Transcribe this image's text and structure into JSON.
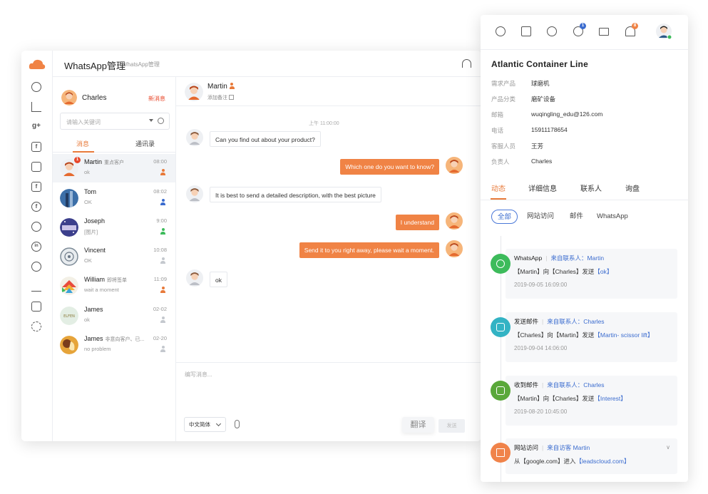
{
  "colors": {
    "accent": "#e87a3a",
    "orange_bubble": "#f08345",
    "link": "#3b6ccf",
    "whatsapp": "#3dbb5b",
    "email_out": "#33b3c4",
    "email_in": "#5aa83a",
    "visit": "#f0834a"
  },
  "main": {
    "title": "WhatsApp管理",
    "subtitle": "WhatsApp管理",
    "headset_icon": "headset-icon",
    "rail_icons": [
      "dashboard-icon",
      "chart-icon",
      "google-plus-icon",
      "facebook-icon",
      "inbox-icon",
      "facebook-2-icon",
      "facebook-circle-icon",
      "whatsapp-icon",
      "linkedin-icon",
      "pie-icon",
      "bar-chart-icon",
      "stock-icon",
      "settings-icon"
    ]
  },
  "sidebar": {
    "user_name": "Charles",
    "new_msg_label": "新消息",
    "search_placeholder": "请输入关键词",
    "tab_messages": "消息",
    "tab_contacts": "通讯录",
    "contacts": [
      {
        "name": "Martin",
        "tag": "重点客户",
        "preview": "ok",
        "time": "08:00",
        "badge": "1",
        "person": "orange"
      },
      {
        "name": "Tom",
        "tag": "",
        "preview": "OK",
        "time": "08:02",
        "person": "blue"
      },
      {
        "name": "Joseph",
        "tag": "",
        "preview": "[图片]",
        "time": "9:00",
        "person": "green"
      },
      {
        "name": "Vincent",
        "tag": "",
        "preview": "OK",
        "time": "10:08",
        "person": "gray"
      },
      {
        "name": "William",
        "tag": "即将签单",
        "preview": "wait a moment",
        "time": "11:09",
        "person": "orange"
      },
      {
        "name": "James",
        "tag": "",
        "preview": "ok",
        "time": "02-02",
        "person": "gray"
      },
      {
        "name": "James",
        "tag": "非意向客户、已...",
        "preview": "no problem",
        "time": "02-20",
        "person": "gray"
      }
    ]
  },
  "chat": {
    "contact_name": "Martin",
    "add_note": "添加备注",
    "timestamp": "上午 11:00:00",
    "messages": [
      {
        "dir": "in",
        "text": "Can you find out about your product?"
      },
      {
        "dir": "out",
        "text": "Which one do you want to know?"
      },
      {
        "dir": "in",
        "text": "It is best to send a detailed description, with the best picture"
      },
      {
        "dir": "out",
        "text": "I understand"
      },
      {
        "dir": "out",
        "text": "Send it to you right away, please wait a moment."
      },
      {
        "dir": "in",
        "text": "ok"
      }
    ],
    "compose_placeholder": "编写消息...",
    "language": "中文简体",
    "translate_label": "翻译",
    "send_label": "发送"
  },
  "panel": {
    "top_icons": [
      "facebook-icon",
      "monitor-icon",
      "facebook-alt-icon",
      "whatsapp-icon",
      "mail-icon",
      "bell-icon",
      "avatar"
    ],
    "whatsapp_badge": "1",
    "bell_badge": "8",
    "company": "Atlantic Container Line",
    "fields": [
      {
        "k": "需求产品",
        "v": "球磨机"
      },
      {
        "k": "产品分类",
        "v": "磨矿设备"
      },
      {
        "k": "邮箱",
        "v": "wuqingling_edu@126.com"
      },
      {
        "k": "电话",
        "v": "15911178654"
      },
      {
        "k": "客服人员",
        "v": "王芳"
      },
      {
        "k": "负责人",
        "v": "Charles"
      }
    ],
    "tabs": [
      "动态",
      "详细信息",
      "联系人",
      "询盘"
    ],
    "filters": [
      "全部",
      "网站访问",
      "邮件",
      "WhatsApp"
    ],
    "events": [
      {
        "type": "WhatsApp",
        "source": "来自联系人：Martin",
        "pre": "【Martin】向【Charles】发送",
        "link": "【ok】",
        "date": "2019-09-05 16:09:00"
      },
      {
        "type": "发送邮件",
        "source": "来自联系人：Charles",
        "pre": "【Charles】向【Martin】发送",
        "link": "【Martin- scissor lift】",
        "date": "2019-09-04 14:06:00"
      },
      {
        "type": "收到邮件",
        "source": "来自联系人：Charles",
        "pre": "【Martin】向【Charles】发送",
        "link": "【Interest】",
        "date": "2019-08-20 10:45:00"
      },
      {
        "type": "网站访问",
        "source": "来自访客 Martin",
        "pre": "从【google.com】进入",
        "link": "【leadscloud.com】",
        "date": ""
      }
    ]
  }
}
